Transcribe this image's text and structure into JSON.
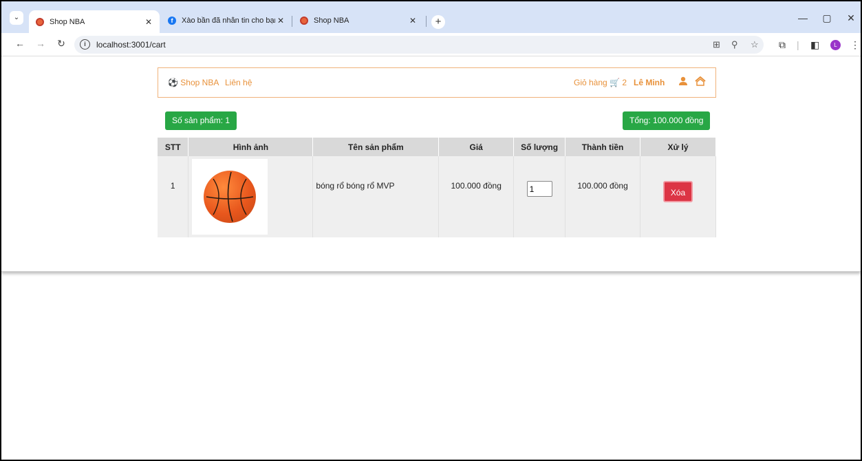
{
  "browser": {
    "tabs": [
      {
        "title": "Shop NBA",
        "favicon": "basketball-icon"
      },
      {
        "title": "Xào bần đã nhắn tin cho bạn",
        "favicon": "facebook-icon"
      },
      {
        "title": "Shop NBA",
        "favicon": "basketball-icon"
      }
    ],
    "url": "localhost:3001/cart"
  },
  "nav": {
    "brand": "Shop NBA",
    "contact": "Liên hệ",
    "cart_label": "Giỏ hàng",
    "cart_count": "2",
    "user_name": "Lê Minh"
  },
  "summary": {
    "product_count": "Số sản phẩm: 1",
    "total": "Tổng: 100.000 đồng"
  },
  "table": {
    "headers": [
      "STT",
      "Hình ảnh",
      "Tên sản phẩm",
      "Giá",
      "Số lượng",
      "Thành tiền",
      "Xử lý"
    ],
    "rows": [
      {
        "index": "1",
        "name": "bóng rổ bóng rổ MVP",
        "price": "100.000 đồng",
        "quantity": "1",
        "subtotal": "100.000 đồng",
        "action": "Xóa"
      }
    ]
  },
  "colors": {
    "accent": "#e8913a",
    "success": "#28a745",
    "danger": "#dc3545"
  }
}
